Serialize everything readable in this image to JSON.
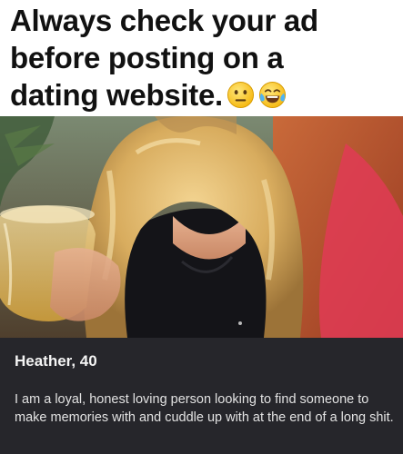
{
  "caption": {
    "lines": [
      "Always check your ad",
      "before posting on a",
      "dating website."
    ],
    "emojis": [
      "neutral-face-emoji",
      "tears-of-joy-emoji"
    ]
  },
  "profile": {
    "name_age": "Heather, 40",
    "bio": "I am a loyal, honest loving person looking to find someone to make memories with and cuddle up with at the end of a long shit."
  },
  "colors": {
    "caption_bg": "#ffffff",
    "caption_text": "#111111",
    "card_bg": "#26262b",
    "card_text": "#f4f4f4"
  }
}
